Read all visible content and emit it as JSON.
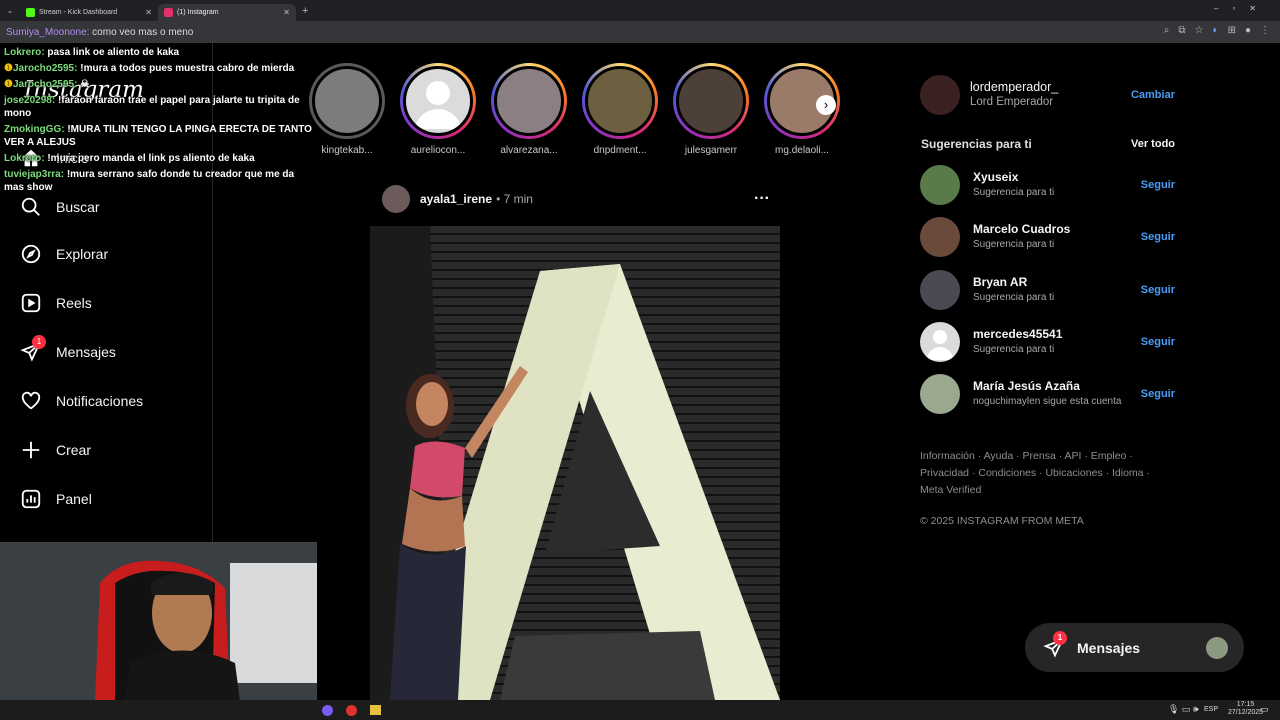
{
  "browser": {
    "tabs": [
      {
        "label": "Stream - Kick Dashboard",
        "color": "#53fc18"
      },
      {
        "label": "(1) Instagram",
        "color": "#e1306c"
      }
    ],
    "url_overlay": "Sumiya_Moonone: como veo mas o meno"
  },
  "chat": [
    {
      "user": "Sumiya_Moonone:",
      "text": "como veo mas o meno",
      "cls": "u2"
    },
    {
      "user": "Lokrero:",
      "text": "pasa link oe aliento de kaka",
      "cls": "u"
    },
    {
      "user": "Jarocho2595:",
      "text": "!mura a todos pues muestra cabro de mierda",
      "cls": "u"
    },
    {
      "user": "Jarocho2595:",
      "text": "☠",
      "cls": "u"
    },
    {
      "user": "jose20298:",
      "text": "!faraon faraon trae el papel para jalarte tu tripita de mono",
      "cls": "u"
    },
    {
      "user": "ZmokingGG:",
      "text": "!MURA TILIN TENGO LA PINGA ERECTA DE TANTO VER A ALEJUS",
      "cls": "u"
    },
    {
      "user": "Lokrero:",
      "text": "!mura pero manda el link ps aliento de kaka",
      "cls": "u"
    },
    {
      "user": "tuviejap3rra:",
      "text": "!mura serrano safo donde tu creador que me da mas show",
      "cls": "u"
    }
  ],
  "sidebar": {
    "logo": "Instagram",
    "items": [
      {
        "label": "Inicio",
        "icon": "home-icon"
      },
      {
        "label": "Buscar",
        "icon": "search-icon"
      },
      {
        "label": "Explorar",
        "icon": "compass-icon"
      },
      {
        "label": "Reels",
        "icon": "reels-icon"
      },
      {
        "label": "Mensajes",
        "icon": "messenger-icon",
        "badge": "1"
      },
      {
        "label": "Notificaciones",
        "icon": "heart-icon"
      },
      {
        "label": "Crear",
        "icon": "plus-icon"
      },
      {
        "label": "Panel",
        "icon": "chart-icon"
      }
    ]
  },
  "stories": [
    {
      "name": "kingtekab...",
      "seen": true
    },
    {
      "name": "aureliocon...",
      "seen": false
    },
    {
      "name": "alvarezana...",
      "seen": false
    },
    {
      "name": "dnpdment...",
      "seen": false
    },
    {
      "name": "julesgamerr",
      "seen": false
    },
    {
      "name": "mg.delaoli...",
      "seen": false
    }
  ],
  "post": {
    "username": "ayala1_irene",
    "time": "• 7 min",
    "letter": "A"
  },
  "right": {
    "user": {
      "handle": "lordemperador_",
      "name": "Lord Emperador",
      "switch": "Cambiar"
    },
    "suggestions_title": "Sugerencias para ti",
    "see_all": "Ver todo",
    "suggestions": [
      {
        "name": "Xyuseix",
        "sub": "Sugerencia para ti",
        "action": "Seguir"
      },
      {
        "name": "Marcelo Cuadros",
        "sub": "Sugerencia para ti",
        "action": "Seguir"
      },
      {
        "name": "Bryan AR",
        "sub": "Sugerencia para ti",
        "action": "Seguir"
      },
      {
        "name": "mercedes45541",
        "sub": "Sugerencia para ti",
        "action": "Seguir"
      },
      {
        "name": "María Jesús Azaña",
        "sub": "noguchimaylen sigue esta cuenta",
        "action": "Seguir"
      }
    ],
    "footer_links": "Información · Ayuda · Prensa · API · Empleo · Privacidad · Condiciones · Ubicaciones · Idioma · Meta Verified",
    "copyright": "© 2025 INSTAGRAM FROM META"
  },
  "messages_button": {
    "label": "Mensajes",
    "badge": "1"
  },
  "taskbar": {
    "lang": "ESP",
    "time": "17:15",
    "date": "27/12/2025"
  }
}
